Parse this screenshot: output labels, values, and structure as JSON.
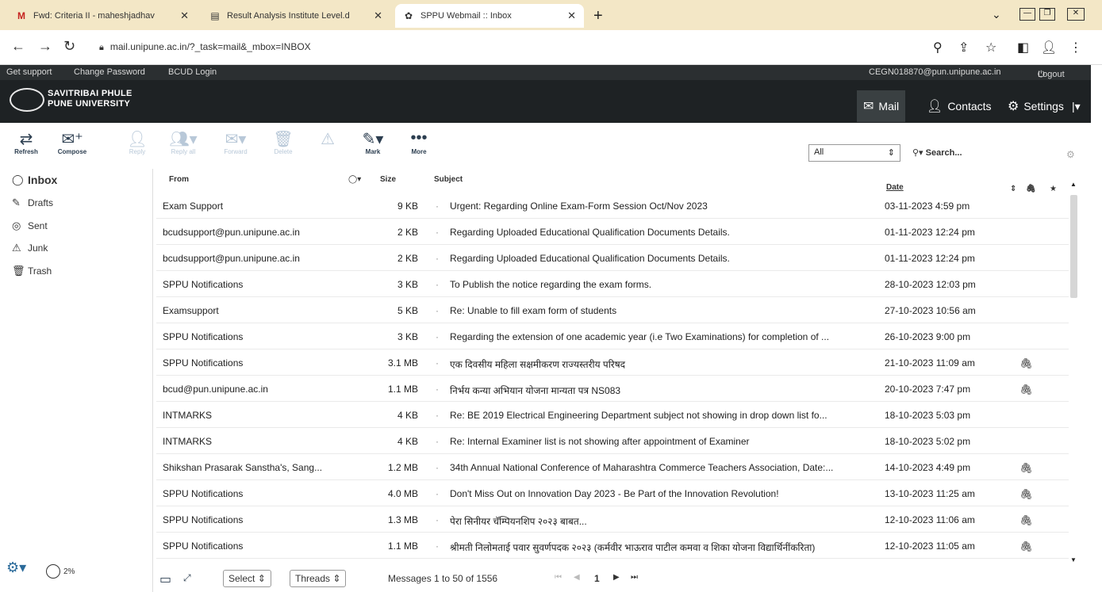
{
  "browser": {
    "tabs": [
      {
        "title": "Fwd: Criteria II - maheshjadhav",
        "favicon": "gmail-icon"
      },
      {
        "title": "Result Analysis Institute Level.d",
        "favicon": "docs-icon"
      },
      {
        "title": "SPPU Webmail :: Inbox",
        "favicon": "webmail-icon"
      }
    ],
    "url": "mail.unipune.ac.in/?_task=mail&_mbox=INBOX"
  },
  "header": {
    "links": [
      "Get support",
      "Change Password",
      "BCUD Login"
    ],
    "user_email": "CEGN018870@pun.unipune.ac.in",
    "logout": "Logout",
    "logo_line1": "SAVITRIBAI PHULE",
    "logo_line2": "PUNE UNIVERSITY",
    "nav": {
      "mail": "Mail",
      "contacts": "Contacts",
      "settings": "Settings"
    }
  },
  "toolbar": {
    "refresh": "Refresh",
    "compose": "Compose",
    "reply": "Reply",
    "reply_all": "Reply all",
    "forward": "Forward",
    "delete": "Delete",
    "mark": "Mark",
    "more": "More",
    "filter_value": "All",
    "search_placeholder": "Search..."
  },
  "folders": [
    "Inbox",
    "Drafts",
    "Sent",
    "Junk",
    "Trash"
  ],
  "quota": "2%",
  "list_header": {
    "from": "From",
    "size": "Size",
    "subject": "Subject",
    "date": "Date"
  },
  "messages": [
    {
      "from": "Exam Support",
      "size": "9 KB",
      "subject": "Urgent: Regarding Online Exam-Form Session Oct/Nov 2023",
      "date": "03-11-2023 4:59 pm",
      "attachment": false,
      "unread": false
    },
    {
      "from": "bcudsupport@pun.unipune.ac.in",
      "size": "2 KB",
      "subject": "Regarding Uploaded Educational Qualification Documents Details.",
      "date": "01-11-2023 12:24 pm",
      "attachment": false,
      "unread": false
    },
    {
      "from": "bcudsupport@pun.unipune.ac.in",
      "size": "2 KB",
      "subject": "Regarding Uploaded Educational Qualification Documents Details.",
      "date": "01-11-2023 12:24 pm",
      "attachment": false,
      "unread": false
    },
    {
      "from": "SPPU Notifications",
      "size": "3 KB",
      "subject": "To Publish the notice regarding the exam forms.",
      "date": "28-10-2023 12:03 pm",
      "attachment": false,
      "unread": false
    },
    {
      "from": "Examsupport",
      "size": "5 KB",
      "subject": "Re: Unable to fill exam form of students",
      "date": "27-10-2023 10:56 am",
      "attachment": false,
      "unread": false
    },
    {
      "from": "SPPU Notifications",
      "size": "3 KB",
      "subject": "Regarding the extension of one academic year (i.e Two Examinations) for completion of ...",
      "date": "26-10-2023 9:00 pm",
      "attachment": false,
      "unread": false
    },
    {
      "from": "SPPU Notifications",
      "size": "3.1 MB",
      "subject": "एक दिवसीय महिला सक्षमीकरण राज्यस्तरीय परिषद",
      "date": "21-10-2023 11:09 am",
      "attachment": true,
      "unread": false
    },
    {
      "from": "bcud@pun.unipune.ac.in",
      "size": "1.1 MB",
      "subject": "निर्भय कन्या अभियान योजना मान्यता पत्र NS083",
      "date": "20-10-2023 7:47 pm",
      "attachment": true,
      "unread": false
    },
    {
      "from": "INTMARKS",
      "size": "4 KB",
      "subject": "Re: BE 2019 Electrical Engineering Department subject not showing in drop down list fo...",
      "date": "18-10-2023 5:03 pm",
      "attachment": false,
      "unread": false
    },
    {
      "from": "INTMARKS",
      "size": "4 KB",
      "subject": "Re: Internal Examiner list is not showing after appointment of Examiner",
      "date": "18-10-2023 5:02 pm",
      "attachment": false,
      "unread": false
    },
    {
      "from": "Shikshan Prasarak Sanstha's, Sang...",
      "size": "1.2 MB",
      "subject": "34th Annual National Conference of Maharashtra Commerce Teachers Association, Date:...",
      "date": "14-10-2023 4:49 pm",
      "attachment": true,
      "unread": false
    },
    {
      "from": "SPPU Notifications",
      "size": "4.0 MB",
      "subject": "Don't Miss Out on Innovation Day 2023 - Be Part of the Innovation Revolution!",
      "date": "13-10-2023 11:25 am",
      "attachment": true,
      "unread": false
    },
    {
      "from": "SPPU Notifications",
      "size": "1.3 MB",
      "subject": "पेरा सिनीयर चॅम्पियनशिप २०२३ बाबत...",
      "date": "12-10-2023 11:06 am",
      "attachment": true,
      "unread": false
    },
    {
      "from": "SPPU Notifications",
      "size": "1.1 MB",
      "subject": "श्रीमती निलोमताई पवार सुवर्णपदक २०२३ (कर्मवीर भाऊराव पाटील कमवा व शिका योजना विद्यार्थिनींकरिता)",
      "date": "12-10-2023 11:05 am",
      "attachment": true,
      "unread": false
    }
  ],
  "footer": {
    "select": "Select",
    "threads": "Threads",
    "count": "Messages 1 to 50 of 1556",
    "page": "1"
  }
}
